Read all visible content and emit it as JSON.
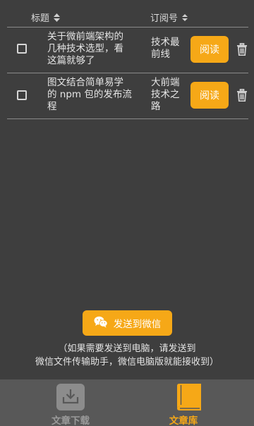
{
  "header": {
    "title_label": "标题",
    "subscription_label": "订阅号"
  },
  "articles": [
    {
      "title_lines": [
        "关于微前端架构的",
        "几种技术选型，看",
        "这篇就够了"
      ],
      "subscription_lines": [
        "技术最",
        "前线"
      ],
      "read_label": "阅读",
      "checked": false
    },
    {
      "title_lines": [
        "图文结合简单易学",
        "的 npm 包的发布流",
        "程"
      ],
      "subscription_lines": [
        "大前端",
        "技术之",
        "路"
      ],
      "read_label": "阅读",
      "checked": false
    }
  ],
  "send_button": {
    "label": "发送到微信",
    "icon": "wechat-icon"
  },
  "note": {
    "line1": "（如果需要发送到电脑，请发送到",
    "line2": "微信文件传输助手，微信电脑版就能接收到）"
  },
  "tabs": [
    {
      "label": "文章下载",
      "icon": "download-icon",
      "active": false
    },
    {
      "label": "文章库",
      "icon": "book-icon",
      "active": true
    }
  ],
  "colors": {
    "background": "#3e3e3e",
    "accent": "#f6a817",
    "tabbar": "#585858",
    "tab_inactive": "#9a9a9a"
  }
}
